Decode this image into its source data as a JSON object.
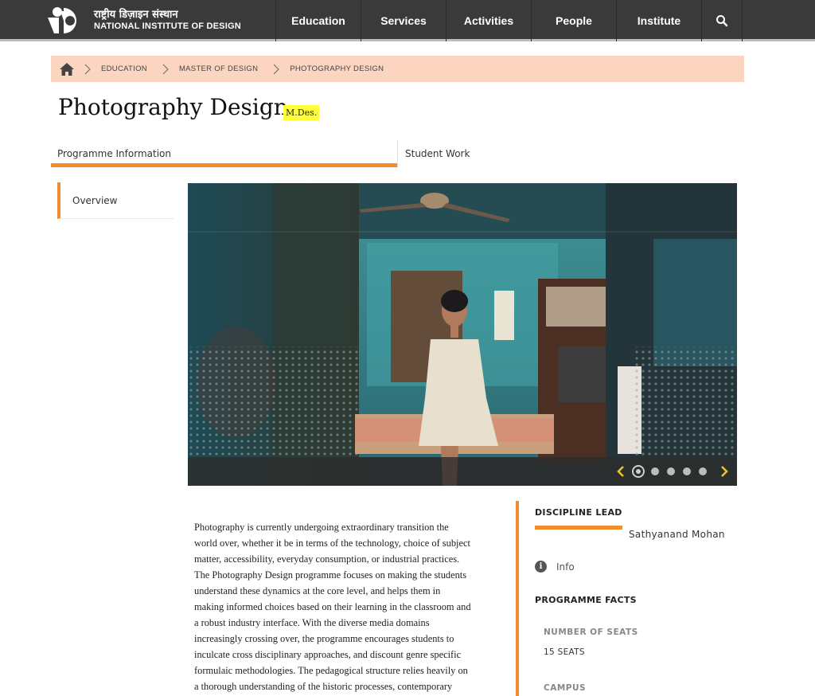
{
  "header": {
    "logo_hindi": "राष्ट्रीय डिज़ाइन संस्थान",
    "logo_english": "NATIONAL INSTITUTE OF DESIGN",
    "nav": [
      "Education",
      "Services",
      "Activities",
      "People",
      "Institute"
    ],
    "search_icon": "search-icon"
  },
  "breadcrumb": {
    "home_icon": "home-icon",
    "items": [
      "EDUCATION",
      "MASTER OF DESIGN",
      "PHOTOGRAPHY DESIGN"
    ]
  },
  "page": {
    "title": "Photography Design",
    "degree": "M.Des."
  },
  "tabs": [
    "Programme Information",
    "Student Work"
  ],
  "sidebar": {
    "items": [
      "Overview"
    ]
  },
  "carousel": {
    "slide_count": 5,
    "active_slide": 1
  },
  "body": {
    "lines": [
      "Photography is currently undergoing extraordinary transition the",
      "world over, whether it be in terms of the technology, choice of subject",
      "matter, accessibility, everyday consumption, or industrial practices.",
      "The Photography Design programme focuses on making the students",
      "understand these dynamics at the core level, and helps them in",
      "making informed choices based on their learning in the classroom and",
      "a robust industry interface. With the diverse media domains",
      "increasingly crossing over, the programme encourages students to",
      "inculcate cross disciplinary approaches, and discount genre specific",
      "formulaic methodologies. The pedagogical structure relies heavily on",
      "a thorough understanding of the historic processes, contemporary"
    ]
  },
  "info": {
    "lead_title": "DISCIPLINE LEAD",
    "lead_name": "Sathyanand Mohan",
    "info_label": "Info",
    "facts_title": "PROGRAMME FACTS",
    "seats_label": "NUMBER OF SEATS",
    "seats_value": "15 SEATS",
    "campus_label": "CAMPUS"
  },
  "colors": {
    "accent": "#f08d2c",
    "header_bg": "#3a3a3a",
    "breadcrumb_bg": "#fbd5c0",
    "badge_bg": "#ffff3a",
    "carousel_arrow": "#f0c030"
  }
}
